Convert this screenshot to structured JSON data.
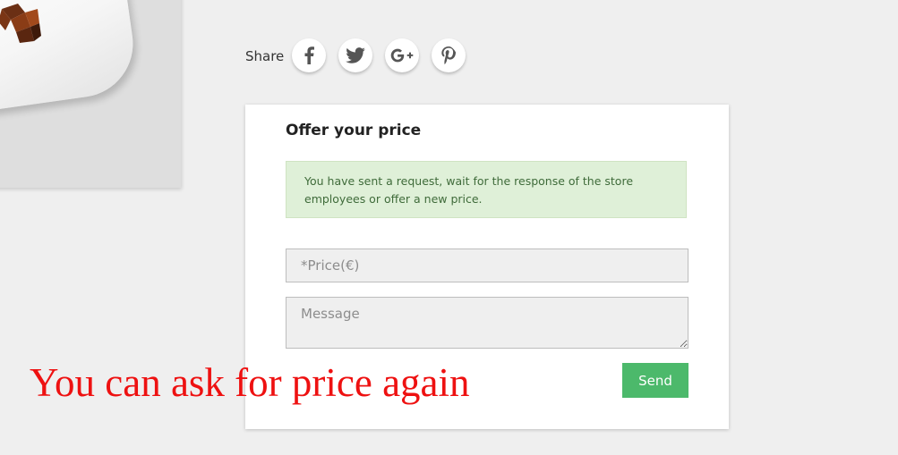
{
  "share": {
    "label": "Share",
    "buttons": [
      {
        "name": "facebook",
        "icon": "facebook-icon"
      },
      {
        "name": "twitter",
        "icon": "twitter-icon"
      },
      {
        "name": "google-plus",
        "icon": "google-plus-icon"
      },
      {
        "name": "pinterest",
        "icon": "pinterest-icon"
      }
    ]
  },
  "offer": {
    "title": "Offer your price",
    "success_message": "You have sent a request, wait for the response of the store employees or offer a new price.",
    "price_placeholder": "*Price(€)",
    "message_placeholder": "Message",
    "send_label": "Send"
  },
  "annotation": {
    "text": "You can ask for price again",
    "color": "#ee1111"
  },
  "colors": {
    "page_background": "#efefef",
    "send_button": "#4cb96b",
    "alert_background": "#dff0d8",
    "alert_text": "#3f6b3a",
    "social_icon": "#555555"
  }
}
